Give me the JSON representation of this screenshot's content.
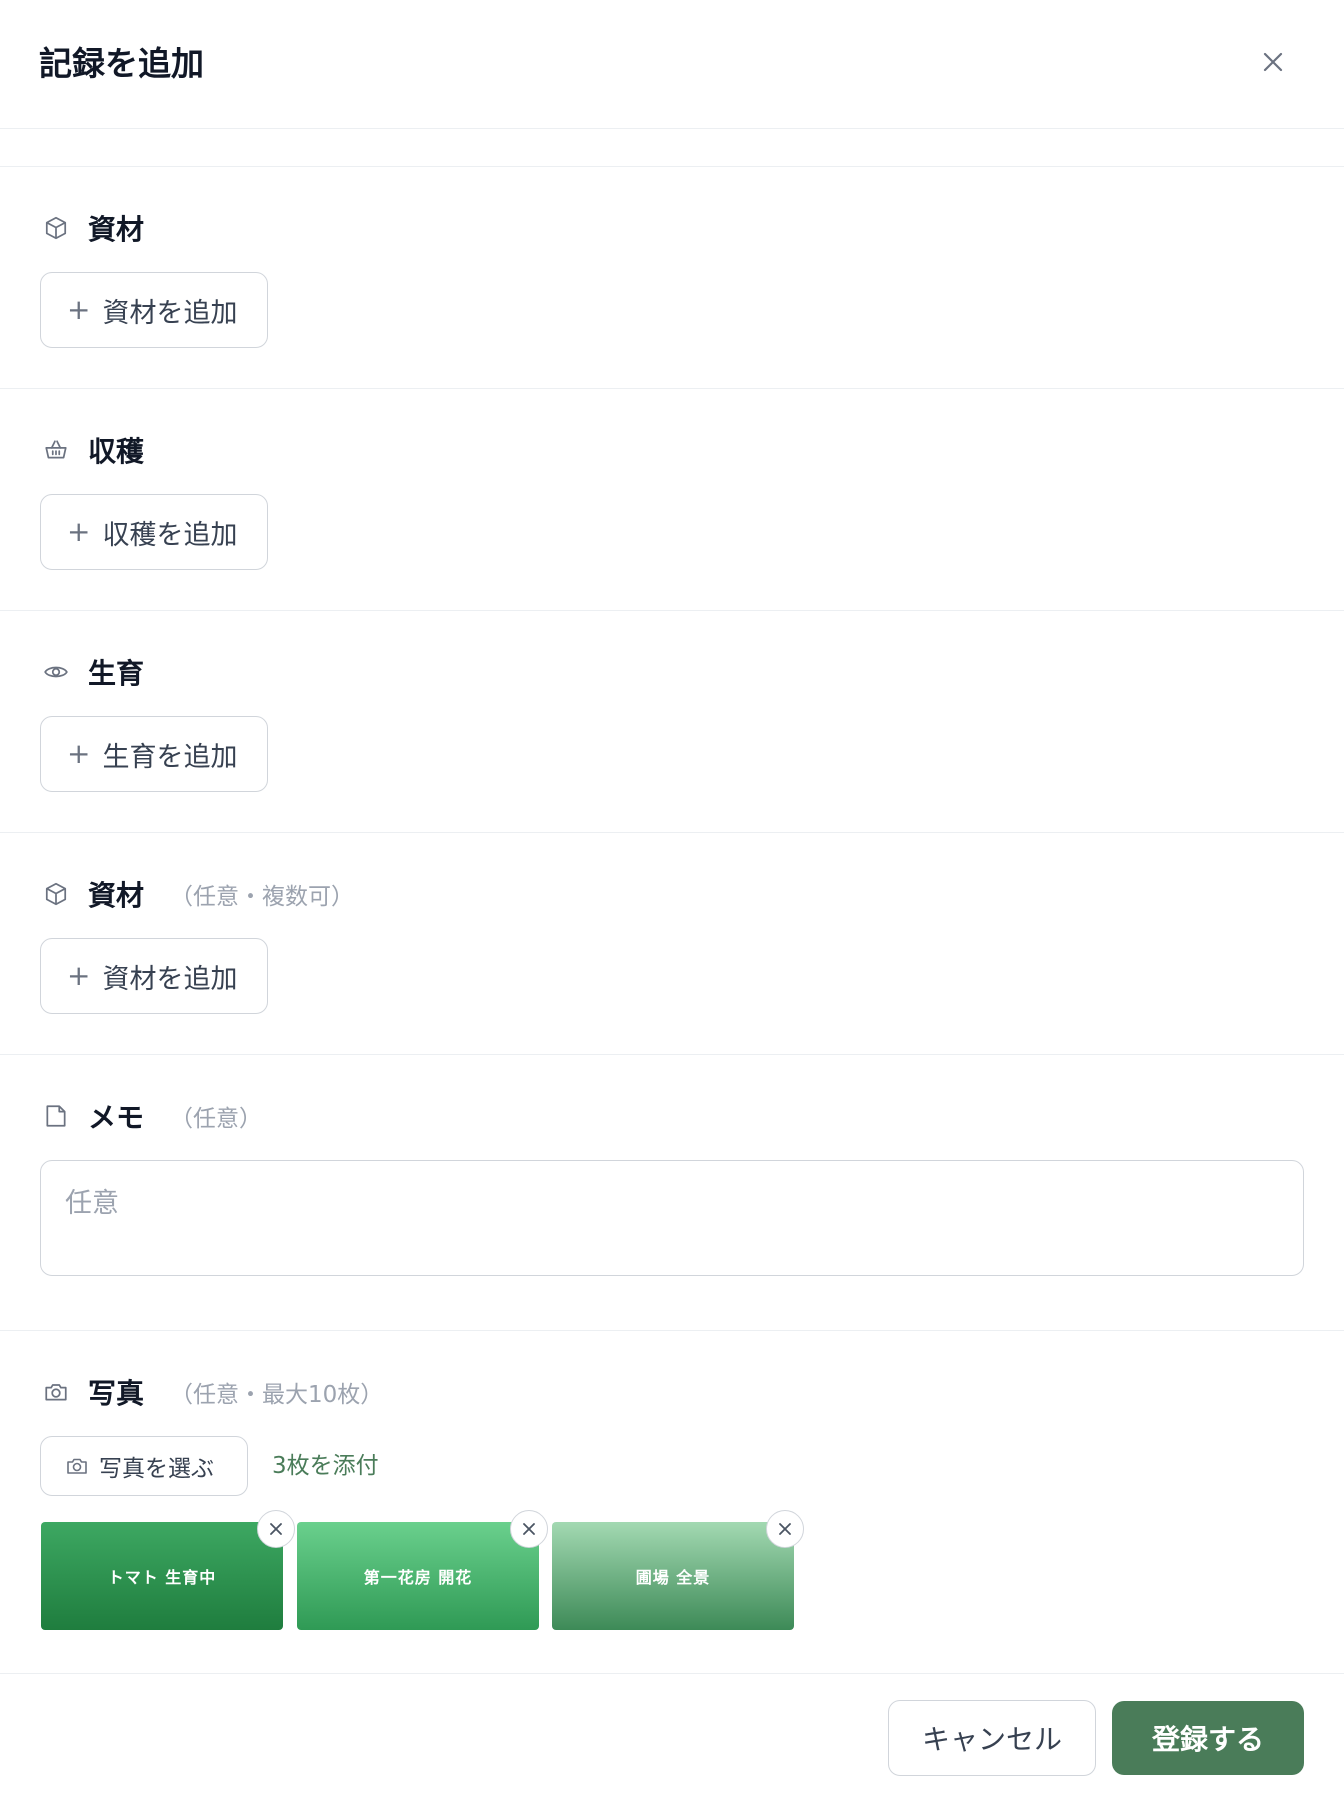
{
  "header": {
    "title": "記録を追加",
    "close_icon": "close-icon"
  },
  "sections": {
    "materials1": {
      "icon": "box-icon",
      "label": "資材",
      "button": "資材を追加"
    },
    "harvest": {
      "icon": "basket-icon",
      "label": "収穫",
      "button": "収穫を追加"
    },
    "growth": {
      "icon": "eye-icon",
      "label": "生育",
      "button": "生育を追加"
    },
    "materials2": {
      "icon": "box-icon",
      "label": "資材",
      "note": "（任意・複数可）",
      "button": "資材を追加"
    },
    "memo": {
      "icon": "file-icon",
      "label": "メモ",
      "note": "（任意）",
      "placeholder": "任意",
      "value": ""
    },
    "photos": {
      "icon": "camera-icon",
      "label": "写真",
      "note": "（任意・最大10枚）",
      "button": "写真を選ぶ",
      "attached": "3枚を添付",
      "items": [
        {
          "caption": "トマト 生育中",
          "color_top": "#3da862",
          "color_bottom": "#1f7d3e"
        },
        {
          "caption": "第一花房 開花",
          "color_top": "#6ad08d",
          "color_bottom": "#2f9a55"
        },
        {
          "caption": "圃場 全景",
          "color_top": "#a3d9b2",
          "color_bottom": "#3d8a57"
        }
      ]
    }
  },
  "footer": {
    "cancel": "キャンセル",
    "submit": "登録する"
  },
  "colors": {
    "accent": "#4a7c59",
    "border": "#d1d5db",
    "muted": "#9ca3af"
  }
}
